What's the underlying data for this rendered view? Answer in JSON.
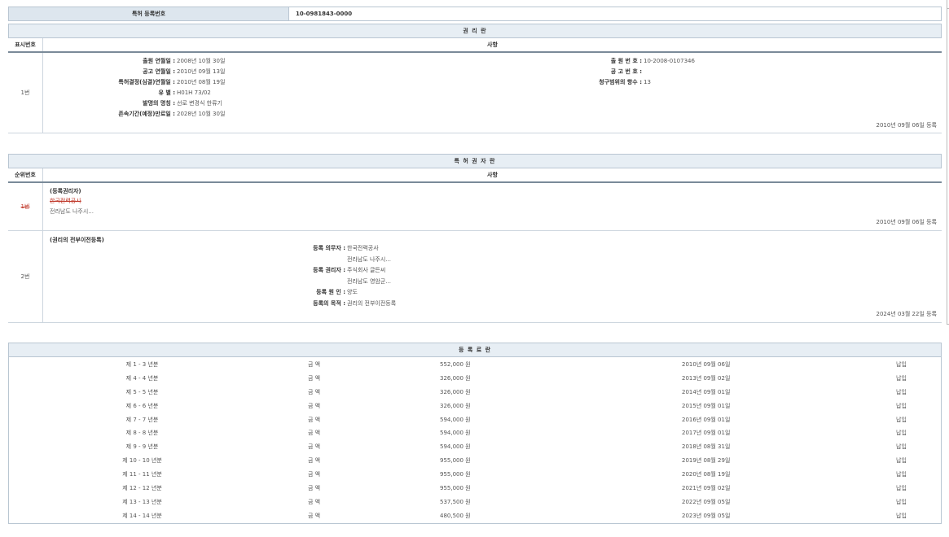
{
  "header": {
    "label": "특허 등록번호",
    "value": "10-0981843-0000"
  },
  "rights": {
    "title": "권 리 란",
    "col1": "표시번호",
    "col2": "사항",
    "row_no": "1번",
    "left_items": [
      {
        "k": "출원 연월일 :",
        "v": "2008년 10월 30일"
      },
      {
        "k": "공고 연월일 :",
        "v": "2010년 09월 13일"
      },
      {
        "k": "특허결정(심결)연월일 :",
        "v": "2010년 08월 19일"
      },
      {
        "k": "유 별 :",
        "v": "H01H 73/02"
      },
      {
        "k": "발명의 명칭 :",
        "v": "선로 변경식 한류기"
      },
      {
        "k": "존속기간(예정)만료일 :",
        "v": "2028년 10월 30일"
      }
    ],
    "right_items": [
      {
        "k": "출 원 번 호 :",
        "v": "10-2008-0107346"
      },
      {
        "k": "공 고 번 호 :",
        "v": ""
      },
      {
        "k": "청구범위의 항수 :",
        "v": "13"
      }
    ],
    "reg_date": "2010년 09월 06일 등록"
  },
  "holders": {
    "title": "특 허 권 자 란",
    "col1": "순위번호",
    "col2": "사항",
    "row1": {
      "no": "1번",
      "heading": "(등록권리자)",
      "name": "한국전력공사",
      "addr": "전라남도 나주시...",
      "reg_date": "2010년 09월 06일 등록"
    },
    "row2": {
      "no": "2번",
      "heading": "(권리의 전부이전등록)",
      "items": [
        {
          "k": "등록 의무자 :",
          "v": "한국전력공사"
        },
        {
          "k": "",
          "v": "전라남도 나주시..."
        },
        {
          "k": "등록 권리자 :",
          "v": "주식회사 글든씨"
        },
        {
          "k": "",
          "v": "전라남도 영암군..."
        },
        {
          "k": "등록 원 인 :",
          "v": "양도"
        },
        {
          "k": "등록의 목적 :",
          "v": "권리의 전부이전등록"
        }
      ],
      "reg_date": "2024년 03월 22일 등록"
    }
  },
  "fees": {
    "title": "등 록 료 란",
    "rows": [
      {
        "year": "제 1 - 3 년분",
        "label": "금 액",
        "amount": "552,000 원",
        "date": "2010년 09월 06일",
        "status": "납입"
      },
      {
        "year": "제 4 - 4 년분",
        "label": "금 액",
        "amount": "326,000 원",
        "date": "2013년 09월 02일",
        "status": "납입"
      },
      {
        "year": "제 5 - 5 년분",
        "label": "금 액",
        "amount": "326,000 원",
        "date": "2014년 09월 01일",
        "status": "납입"
      },
      {
        "year": "제 6 - 6 년분",
        "label": "금 액",
        "amount": "326,000 원",
        "date": "2015년 09월 01일",
        "status": "납입"
      },
      {
        "year": "제 7 - 7 년분",
        "label": "금 액",
        "amount": "594,000 원",
        "date": "2016년 09월 01일",
        "status": "납입"
      },
      {
        "year": "제 8 - 8 년분",
        "label": "금 액",
        "amount": "594,000 원",
        "date": "2017년 09월 01일",
        "status": "납입"
      },
      {
        "year": "제 9 - 9 년분",
        "label": "금 액",
        "amount": "594,000 원",
        "date": "2018년 08월 31일",
        "status": "납입"
      },
      {
        "year": "제 10 - 10 년분",
        "label": "금 액",
        "amount": "955,000 원",
        "date": "2019년 08월 29일",
        "status": "납입"
      },
      {
        "year": "제 11 - 11 년분",
        "label": "금 액",
        "amount": "955,000 원",
        "date": "2020년 08월 19일",
        "status": "납입"
      },
      {
        "year": "제 12 - 12 년분",
        "label": "금 액",
        "amount": "955,000 원",
        "date": "2021년 09월 02일",
        "status": "납입"
      },
      {
        "year": "제 13 - 13 년분",
        "label": "금 액",
        "amount": "537,500 원",
        "date": "2022년 09월 05일",
        "status": "납입"
      },
      {
        "year": "제 14 - 14 년분",
        "label": "금 액",
        "amount": "480,500 원",
        "date": "2023년 09월 05일",
        "status": "납입"
      }
    ]
  }
}
